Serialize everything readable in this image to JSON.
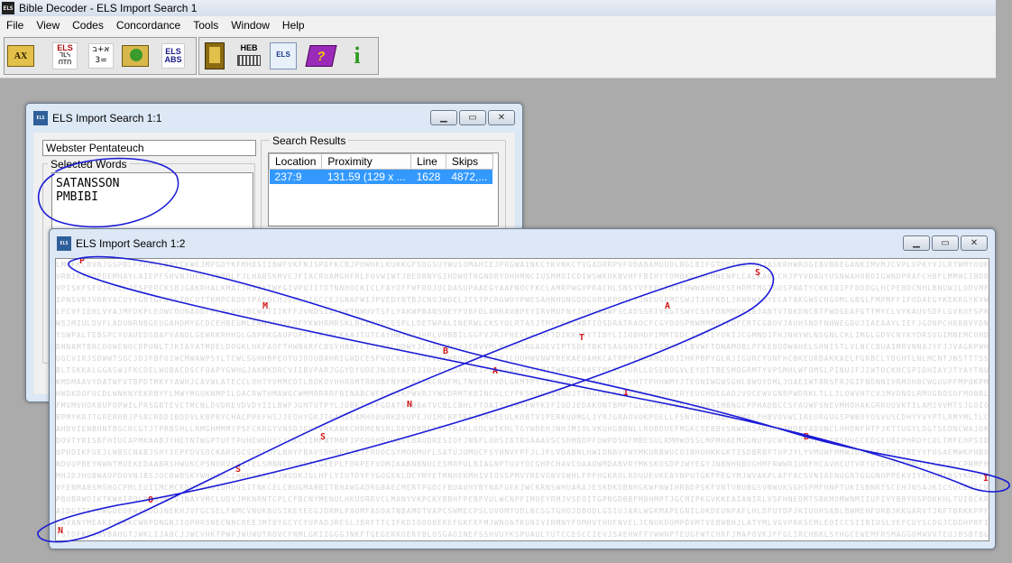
{
  "app": {
    "title": "Bible Decoder - ELS Import Search 1",
    "icon_text": "ELS"
  },
  "menu": [
    "File",
    "View",
    "Codes",
    "Concordance",
    "Tools",
    "Window",
    "Help"
  ],
  "toolbar": {
    "buttons": [
      {
        "icon": "ax-book-icon",
        "label": "AX"
      },
      {
        "icon": "els-hebrew-icon",
        "label": "ELS"
      },
      {
        "icon": "gematria-icon",
        "label": "א+ב =3"
      },
      {
        "icon": "globe-book-icon",
        "label": ""
      },
      {
        "icon": "els-abs-icon",
        "label": "ELS ABS"
      },
      {
        "icon": "bible-book-icon",
        "label": ""
      },
      {
        "icon": "heb-keyboard-icon",
        "label": "HEB"
      },
      {
        "icon": "els-import-icon",
        "label": "ELS"
      },
      {
        "icon": "help-book-icon",
        "label": "?"
      },
      {
        "icon": "info-icon",
        "label": "i"
      }
    ]
  },
  "window1": {
    "title": "ELS Import Search 1:1",
    "icon_text": "ELS",
    "text_source": "Webster Pentateuch",
    "selected_words_label": "Selected Words",
    "selected_words": [
      "SATANSSON",
      "PMBIBI"
    ],
    "search_results_label": "Search Results",
    "columns": [
      "Location",
      "Proximity",
      "Line",
      "Skips"
    ],
    "rows": [
      {
        "location": "237:9",
        "proximity": "131.59 (129 x ...",
        "line": "1628",
        "skips": "4872,..."
      }
    ]
  },
  "window2": {
    "title": "ELS Import Search 1:2",
    "icon_text": "ELS",
    "highlight_letters": [
      "P",
      "S",
      "M",
      "A",
      "T",
      "B",
      "A",
      "I",
      "N",
      "S",
      "B",
      "S",
      "O",
      "I",
      "N"
    ]
  },
  "colors": {
    "accent": "#3399ff",
    "highlight": "#d31818",
    "annotation": "#1a1ad6"
  }
}
